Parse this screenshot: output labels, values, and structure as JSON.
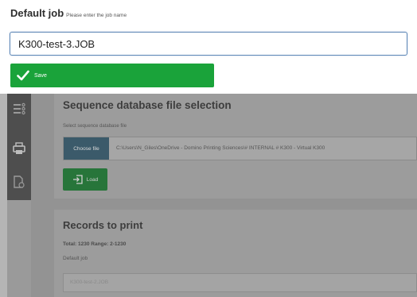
{
  "dialog": {
    "title": "Default job",
    "hint": "Please enter the job name",
    "job_name_value": "K300-test-3.JOB",
    "save_label": "Save"
  },
  "background": {
    "sidebar": {
      "icons": [
        "list-icon",
        "printer-icon",
        "document-settings-icon"
      ]
    },
    "sequence_section": {
      "title": "Sequence database file selection",
      "subtitle": "Select sequence database file",
      "choose_file_label": "Choose file",
      "file_path": "C:\\Users\\N_Giles\\OneDrive - Domino Printing Sciences\\# INTERNAL # K300 - Virtual K300",
      "load_label": "Load"
    },
    "records_section": {
      "title": "Records to print",
      "total_range": "Total: 1230 Range: 2-1230",
      "default_job_label": "Default job",
      "default_job_value": "K300-test-2.JOB"
    }
  },
  "colors": {
    "save_green": "#1aa33a",
    "input_border": "#5c86b5",
    "sidebar_dark": "#4e4e4e",
    "overlay_grey": "#999999"
  }
}
